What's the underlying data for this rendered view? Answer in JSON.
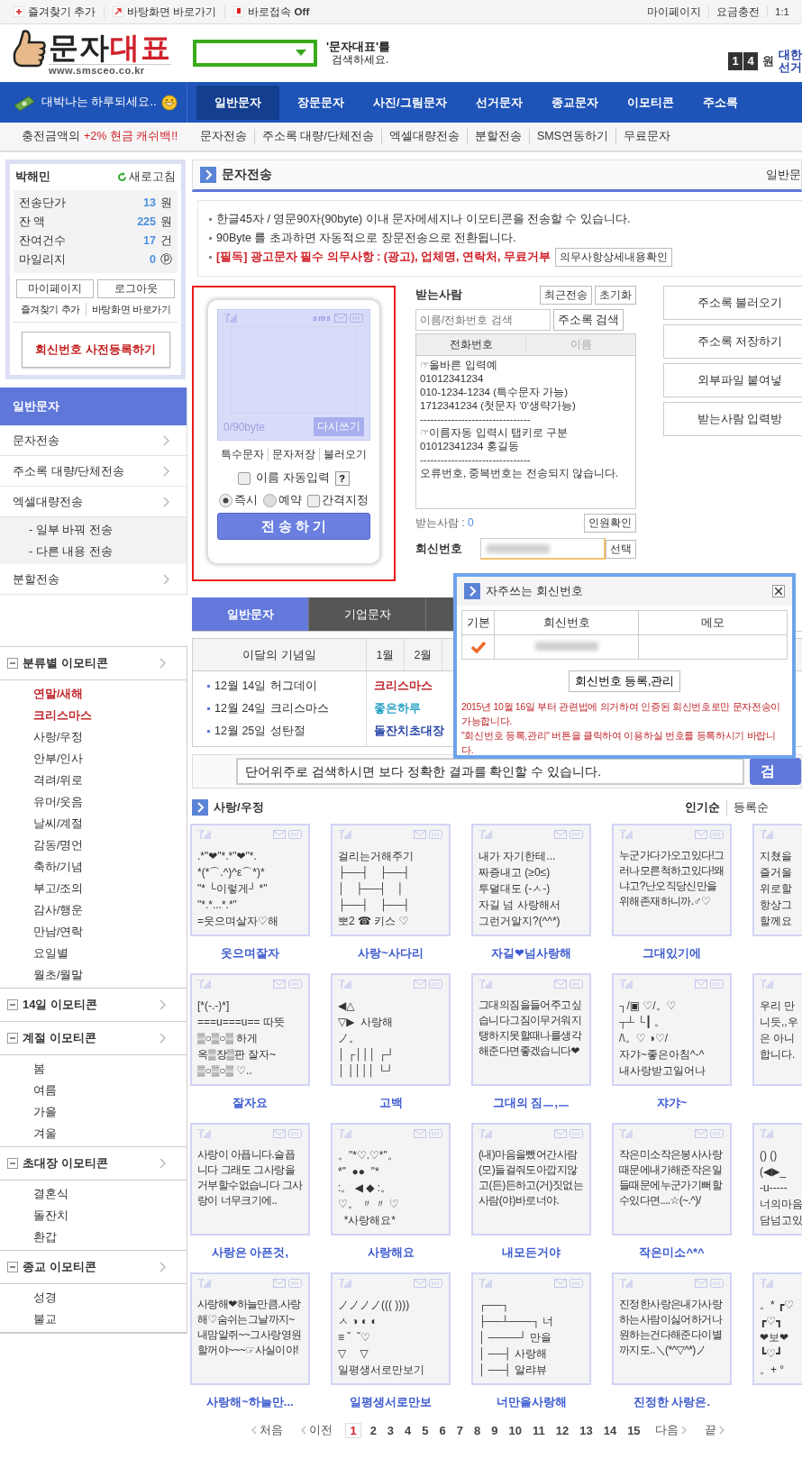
{
  "top_bar": {
    "left_links": [
      {
        "label": "즐겨찾기 추가"
      },
      {
        "label": "바탕화면 바로가기"
      },
      {
        "label": "바로접속 **Off**"
      }
    ],
    "right_links": [
      "마이페이지",
      "요금충전",
      "1:1"
    ]
  },
  "header": {
    "logo_word_1": "문자",
    "logo_word_2": "대표",
    "logo_url": "www.smsceo.co.kr",
    "search_hint_1": "'문자대표'를",
    "search_hint_2": "검색하세요.",
    "price_digits": [
      "1",
      "4"
    ],
    "price_unit": "원",
    "side_links": [
      "대한",
      "선거"
    ]
  },
  "nav": {
    "greeting": "대박나는 하루되세요..",
    "items": [
      {
        "label": "일반문자",
        "selected": true
      },
      {
        "label": "장문문자",
        "selected": false
      },
      {
        "label": "사진/그림문자",
        "selected": false
      },
      {
        "label": "선거문자",
        "selected": false
      },
      {
        "label": "종교문자",
        "selected": false
      },
      {
        "label": "이모티콘",
        "selected": false
      },
      {
        "label": "주소록",
        "selected": false
      }
    ]
  },
  "sub_nav": {
    "promo_prefix": "충전금액의",
    "promo_highlight": "+2% 현금 캐쉬백!!",
    "links": [
      "문자전송",
      "주소록 대량/단체전송",
      "엑셀대량전송",
      "분할전송",
      "SMS연동하기",
      "무료문자"
    ]
  },
  "account": {
    "user": "박해민",
    "refresh": "새로고침",
    "rows": [
      {
        "label": "전송단가",
        "value": "13",
        "unit": "원"
      },
      {
        "label": "잔 액",
        "value": "225",
        "unit": "원"
      },
      {
        "label": "잔여건수",
        "value": "17",
        "unit": "건"
      },
      {
        "label": "마일리지",
        "value": "0",
        "unit": "ⓟ"
      }
    ],
    "buttons": [
      "마이페이지",
      "로그아웃"
    ],
    "links": [
      "즐겨찾기 추가",
      "바탕화면 바로가기"
    ],
    "register_button": "회신번호 사전등록하기"
  },
  "sms_menu": {
    "title": "일반문자",
    "items": [
      {
        "label": "문자전송"
      },
      {
        "label": "주소록 대량/단체전송"
      },
      {
        "label": "엑셀대량전송",
        "children": [
          {
            "label": "- 일부 바꿔 전송"
          },
          {
            "label": "- 다른 내용 전송"
          }
        ]
      },
      {
        "label": "분할전송"
      }
    ]
  },
  "page_title": {
    "title": "문자전송",
    "right": "일반문"
  },
  "notices": [
    {
      "kind": "plain",
      "text": "한글45자 / 영문90자(90byte) 이내 문자메세지나 이모티콘을 전송할 수 있습니다."
    },
    {
      "kind": "plain",
      "text": "90Byte 를 초과하면 자동적으로 장문전송으로 전환됩니다."
    },
    {
      "kind": "warning",
      "text": "[필독] 광고문자 필수 의무사항 : (광고), 업체명, 연락처, 무료거부",
      "button": "의무사항상세내용확인"
    }
  ],
  "composer": {
    "badge": "sms",
    "counter": "0/90byte",
    "rewrite": "다시쓰기",
    "tools": [
      "특수문자",
      "문자저장",
      "불러오기"
    ],
    "auto_name": {
      "label": "이름 자동입력",
      "checked": false,
      "help": "?"
    },
    "send_options": [
      {
        "kind": "radio",
        "label": "즉시",
        "selected": true
      },
      {
        "kind": "radio",
        "label": "예약",
        "selected": false
      },
      {
        "kind": "checkbox",
        "label": "간격지정",
        "checked": false
      }
    ],
    "send_button": "전 송 하 기"
  },
  "recipients": {
    "label": "받는사람",
    "buttons": [
      "최근전송",
      "초기화"
    ],
    "search_placeholder": "이름/전화번호 검색",
    "search_button": "주소록 검색",
    "columns": [
      "전화번호",
      "이름"
    ],
    "example_lines": [
      "☞올바른 입력예",
      "01012341234",
      "010-1234-1234 (특수문자 가능)",
      "1712341234 (첫문자 '0'생략가능)",
      "--------------------------------",
      "☞이름자동 입력시 탭키로 구분",
      "01012341234      홍길동",
      "--------------------------------",
      "오류번호, 중복번호는 전송되지 않습니다."
    ],
    "count_label": "받는사람 :",
    "count": "0",
    "check_button": "인원확인",
    "reply_label": "회신번호",
    "select_button": "선택"
  },
  "side_buttons": [
    "주소록 불러오기",
    "주소록 저장하기",
    "외부파일 붙여넣",
    "받는사람 입력방"
  ],
  "tabs": [
    {
      "label": "일반문자",
      "selected": true
    },
    {
      "label": "기업문자",
      "selected": false
    }
  ],
  "anniversary": {
    "title": "이달의 기념일",
    "months": [
      "1월",
      "2월"
    ],
    "events": [
      {
        "date": "12월 14일",
        "name": "허그데이"
      },
      {
        "date": "12월 24일",
        "name": "크리스마스"
      },
      {
        "date": "12월 25일",
        "name": "성탄절"
      }
    ],
    "tags": [
      {
        "label": "크리스마스",
        "color": "#c0282d"
      },
      {
        "label": "좋은하루",
        "color": "#2aa3c6"
      },
      {
        "label": "돌잔치초대장",
        "color": "#2744a6"
      }
    ]
  },
  "popup": {
    "title": "자주쓰는 회신번호",
    "columns": [
      "기본",
      "회신번호",
      "메모"
    ],
    "rows": [
      {
        "default": true
      }
    ],
    "manage_button": "회신번호 등록,관리",
    "notices": [
      "2015년 10월 16일 부터 관련법에 의거하여 인증된 회신번호로만 문자전송이 가능합니다.",
      "\"회신번호 등록,관리\" 버튼을 클릭하여 이용하실 번호를 등록하시기 바랍니다."
    ]
  },
  "search": {
    "placeholder": "단어위주로 검색하시면 보다 정확한 결과를 확인할 수 있습니다.",
    "button": "검"
  },
  "section": {
    "title": "사랑/우정",
    "sorts": [
      {
        "label": "인기순",
        "selected": true
      },
      {
        "label": "등록순",
        "selected": false
      }
    ]
  },
  "cards": [
    {
      "kind": "art",
      "lines": [
        ".*\"❤\"*.*\"❤\"*.",
        "*(*⌒.^)^ε⌒*)*",
        "\"* └이렇게┘ *\"",
        "\"*.*...*.*\"",
        "=웃으며살자♡해"
      ],
      "title": "웃으며잘자"
    },
    {
      "kind": "art",
      "lines": [
        "걸리는거해주기",
        "├──┤　├──┤",
        "│　├──┤　│",
        "├──┤　├──┤",
        "뽀2 ☎ 키스 ♡"
      ],
      "title": "사랑~사다리"
    },
    {
      "kind": "art",
      "lines": [
        "내가 자기한테...",
        "짜증내고 (≥0≤)",
        "투덜대도 (-ㅅ-)",
        "자길 넘 사랑해서",
        "그런거알지?(^^*)"
      ],
      "title": "자길❤넘사랑해"
    },
    {
      "kind": "text",
      "text": "누군가다가오고있다!그러나모른척하고있다!왜냐고?난오직당신만을위해존재하니까.♂♡",
      "title": "그대있기에"
    },
    {
      "kind": "art",
      "lines": [
        "지쳤을",
        "즐거울",
        "위로할",
        "항상그",
        "할께요"
      ]
    },
    {
      "kind": "art",
      "lines": [
        "[*(-.-)*]",
        "===u===u== 따뜻",
        "▒○▒○▒ 하게",
        "옥▒장▒판 잘자~",
        "▒○▒○▒ ♡.."
      ],
      "title": "잘자요"
    },
    {
      "kind": "art",
      "lines": [
        "◀△",
        "▽▶  사랑해",
        "ノ。",
        "│ ┌│││ ┌┘",
        "│ ││││ └┘"
      ],
      "title": "고백"
    },
    {
      "kind": "text",
      "text": "그대의짐을들어주고싶습니다그짐이무거워지탱하지못할때나를생각해준다면좋겠습니다❤",
      "title": "그대의 짐ㅡ,ㅡ"
    },
    {
      "kind": "art",
      "lines": [
        "┐/▣ ♡/。♡",
        "┬┴ └┃ 。",
        "/\\。♡ ◑♡/",
        "자갸~좋은아침^-^",
        "내사랑받고일어나"
      ],
      "title": "쟈갸~"
    },
    {
      "kind": "art",
      "lines": [
        "우리 만",
        "니듯,,우",
        "은 아니",
        "합니다."
      ]
    },
    {
      "kind": "text",
      "text": "사랑이 아픕니다.슬픕니다 그래도 그사랑을 거부할수없습니다 그사랑이 너무크기에..",
      "title": "사랑은 아픈것,"
    },
    {
      "kind": "art",
      "lines": [
        "。\"*♡.♡*\"。",
        "*\"  ●●  \"*",
        ":。 ◀ ◆ :。",
        "♡。 〃 〃 ♡",
        "  *사랑해요*"
      ],
      "title": "사랑해요"
    },
    {
      "kind": "text",
      "text": "(내)마음을뺐어간사람(모)들걸줘도아깝지않고(든)든하고(거)짓없는사람(야)바로너야.",
      "title": "내모든거야"
    },
    {
      "kind": "text",
      "text": "작은미소작은봉사사랑때문에내가해준작은일들때문에누군가기뻐할수있다면....☆(~.^)/",
      "title": "작은미소^*^"
    },
    {
      "kind": "art",
      "lines": [
        "() ()",
        "(◀▶_",
        "-u-----",
        "너의마음",
        "담넘고있"
      ]
    },
    {
      "kind": "text",
      "text": "사랑해❤하늘만큼.사랑해♡숨쉬는그날까지~내맘알쥐~~그사랑영원할꺼야~~~☞사실이야!",
      "title": "사랑해~하늘만..."
    },
    {
      "kind": "art",
      "lines": [
        "ノノノノ((( ))))",
        "ㅅ ◑ ◐ ◐",
        "≡ ˇ  ˇ♡",
        "▽　 ▽",
        "일평생서로만보기"
      ],
      "title": "일평생서로만보"
    },
    {
      "kind": "art",
      "lines": [
        "┌──┐",
        "├──┴───┐ 너",
        "│ ────┘ 만을",
        "│ ──┤ 사랑해",
        "│ ──┤ 알랴뷰"
      ],
      "title": "너만을사랑해"
    },
    {
      "kind": "text",
      "text": "진정한사랑은내가사랑하는사람이싫어하거나원하는건다해준다이별까지도..＼(*^▽^*)ノ",
      "title": "진정한 사랑은."
    },
    {
      "kind": "art",
      "lines": [
        "。* ┏♡",
        "┏♡┓",
        "❤보❤",
        "┗♡┛",
        "。+ °"
      ]
    }
  ],
  "pagination": {
    "first": "처음",
    "prev": "이전",
    "pages": [
      {
        "label": "1",
        "selected": true
      },
      {
        "label": "2",
        "selected": false
      },
      {
        "label": "3",
        "selected": false
      },
      {
        "label": "4",
        "selected": false
      },
      {
        "label": "5",
        "selected": false
      },
      {
        "label": "6",
        "selected": false
      },
      {
        "label": "7",
        "selected": false
      },
      {
        "label": "8",
        "selected": false
      },
      {
        "label": "9",
        "selected": false
      },
      {
        "label": "10",
        "selected": false
      },
      {
        "label": "11",
        "selected": false
      },
      {
        "label": "12",
        "selected": false
      },
      {
        "label": "13",
        "selected": false
      },
      {
        "label": "14",
        "selected": false
      },
      {
        "label": "15",
        "selected": false
      }
    ],
    "next": "다음",
    "last": "끝"
  },
  "emoticon_menu": [
    {
      "label": "분류별 이모티콘",
      "expanded": true,
      "children": [
        {
          "label": "연말/새해",
          "highlighted": true
        },
        {
          "label": "크리스마스",
          "highlighted": true
        },
        {
          "label": "사랑/우정",
          "highlighted": false
        },
        {
          "label": "안부/인사",
          "highlighted": false
        },
        {
          "label": "격려/위로",
          "highlighted": false
        },
        {
          "label": "유머/웃음",
          "highlighted": false
        },
        {
          "label": "날씨/계절",
          "highlighted": false
        },
        {
          "label": "감동/명언",
          "highlighted": false
        },
        {
          "label": "축하/기념",
          "highlighted": false
        },
        {
          "label": "부고/조의",
          "highlighted": false
        },
        {
          "label": "감사/행운",
          "highlighted": false
        },
        {
          "label": "만남/연락",
          "highlighted": false
        },
        {
          "label": "요일별",
          "highlighted": false
        },
        {
          "label": "월초/월말",
          "highlighted": false
        }
      ]
    },
    {
      "label": "14일 이모티콘",
      "expanded": true
    },
    {
      "label": "계절 이모티콘",
      "expanded": true,
      "children": [
        {
          "label": "봄",
          "highlighted": false
        },
        {
          "label": "여름",
          "highlighted": false
        },
        {
          "label": "가을",
          "highlighted": false
        },
        {
          "label": "겨울",
          "highlighted": false
        }
      ]
    },
    {
      "label": "초대장 이모티콘",
      "expanded": true,
      "children": [
        {
          "label": "결혼식",
          "highlighted": false
        },
        {
          "label": "돌잔치",
          "highlighted": false
        },
        {
          "label": "환갑",
          "highlighted": false
        }
      ]
    },
    {
      "label": "종교 이모티콘",
      "expanded": true,
      "children": [
        {
          "label": "성경",
          "highlighted": false
        },
        {
          "label": "불교",
          "highlighted": false
        }
      ]
    }
  ]
}
